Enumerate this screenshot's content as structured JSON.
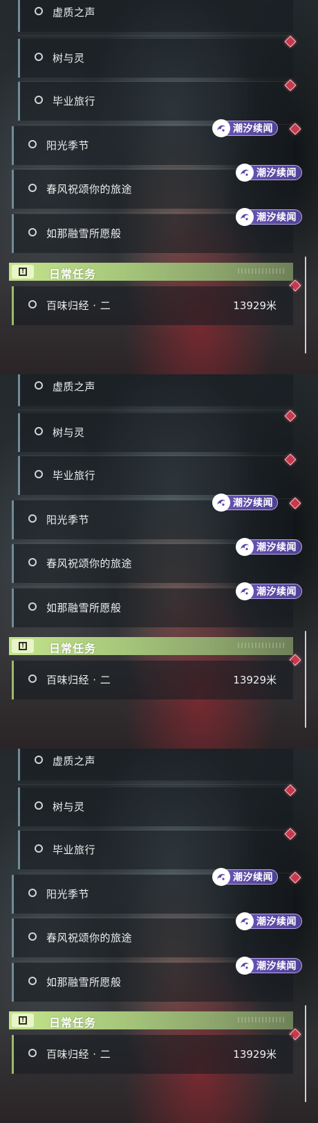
{
  "panels": [
    {
      "quests": [
        {
          "title": "虚质之声"
        },
        {
          "title": "树与灵"
        },
        {
          "title": "毕业旅行"
        },
        {
          "title": "阳光季节"
        },
        {
          "title": "春风祝颂你的旅途"
        },
        {
          "title": "如那融雪所愿般"
        }
      ],
      "event_tag": "潮汐续闻",
      "daily_header": "日常任务",
      "daily": {
        "title": "百味归经 · 二",
        "distance": "13929米"
      }
    },
    {
      "quests": [
        {
          "title": "虚质之声"
        },
        {
          "title": "树与灵"
        },
        {
          "title": "毕业旅行"
        },
        {
          "title": "阳光季节"
        },
        {
          "title": "春风祝颂你的旅途"
        },
        {
          "title": "如那融雪所愿般"
        }
      ],
      "event_tag": "潮汐续闻",
      "daily_header": "日常任务",
      "daily": {
        "title": "百味归经 · 二",
        "distance": "13929米"
      }
    },
    {
      "quests": [
        {
          "title": "虚质之声"
        },
        {
          "title": "树与灵"
        },
        {
          "title": "毕业旅行"
        },
        {
          "title": "阳光季节"
        },
        {
          "title": "春风祝颂你的旅途"
        },
        {
          "title": "如那融雪所愿般"
        }
      ],
      "event_tag": "潮汐续闻",
      "daily_header": "日常任务",
      "daily": {
        "title": "百味归经 · 二",
        "distance": "13929米"
      }
    }
  ],
  "colors": {
    "tag_purple": "#5b4aa2",
    "pin_red": "#c8394d",
    "daily_green": "#a6c67a",
    "quest_border": "#6f8c98"
  },
  "icons": {
    "quest_status": "circle-outline-icon",
    "track_pin": "diamond-pin-icon",
    "event_tag": "tide-swirl-icon",
    "daily_header": "exclamation-box-icon"
  }
}
